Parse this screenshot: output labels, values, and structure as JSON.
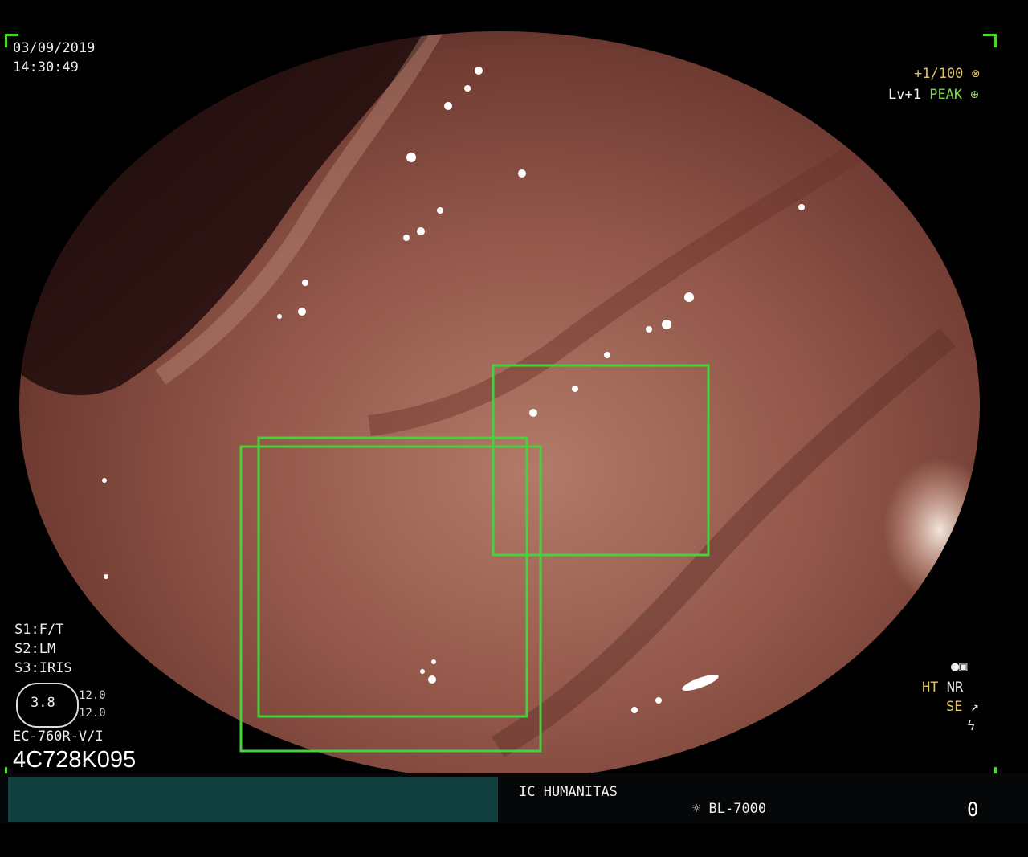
{
  "overlay": {
    "date": "03/09/2019",
    "time": "14:30:49",
    "magnification": "+1/100",
    "enhancement_level": "Lv+1",
    "enhancement_mode": "PEAK",
    "settings": [
      {
        "slot": "S1:",
        "value": "F/T"
      },
      {
        "slot": "S2:",
        "value": "LM"
      },
      {
        "slot": "S3:",
        "value": "IRIS"
      }
    ],
    "gauge_value": "3.8",
    "gauge_scale_top": "12.0",
    "gauge_scale_bottom": "12.0",
    "scope_model": "EC-760R-V/I",
    "serial_number": "4C728K095",
    "right_labels": {
      "ht": "HT",
      "nr": "NR",
      "se": "SE"
    },
    "hospital": "IC HUMANITAS",
    "light_source": "BL-7000",
    "counter": "0"
  },
  "detections": [
    {
      "label": "detection-box"
    },
    {
      "label": "detection-box"
    },
    {
      "label": "detection-box"
    }
  ],
  "colors": {
    "box_green": "#43d33a",
    "mucosa": "#8a4a3e",
    "status_teal": "#103f3d"
  }
}
